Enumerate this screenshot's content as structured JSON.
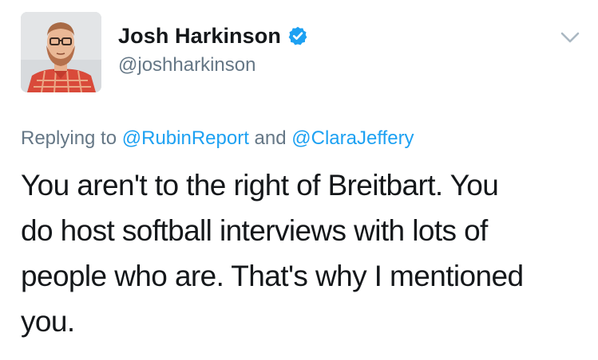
{
  "tweet": {
    "display_name": "Josh Harkinson",
    "handle": "@joshharkinson",
    "verified_icon": "verified-badge-icon",
    "menu_icon": "chevron-down-icon",
    "replying_prefix": "Replying to",
    "reply_user_1": "@RubinReport",
    "reply_joiner": "and",
    "reply_user_2": "@ClaraJeffery",
    "text_lines": [
      "You aren't to the right of Breitbart. You",
      "do host softball interviews with lots of",
      "people who are. That's why I mentioned",
      "you."
    ]
  },
  "colors": {
    "link": "#1da1f2",
    "secondary_text": "#657786",
    "primary_text": "#14171a",
    "verified": "#1da1f2"
  }
}
